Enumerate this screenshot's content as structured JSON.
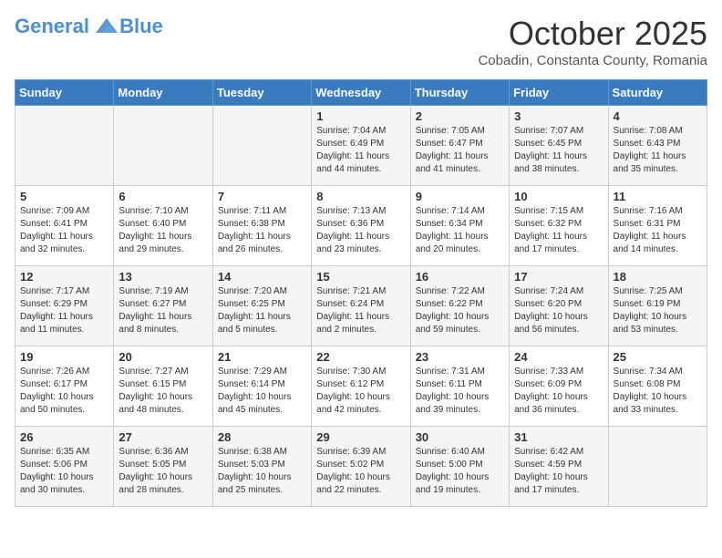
{
  "header": {
    "logo_line1": "General",
    "logo_line2": "Blue",
    "month": "October 2025",
    "location": "Cobadin, Constanta County, Romania"
  },
  "weekdays": [
    "Sunday",
    "Monday",
    "Tuesday",
    "Wednesday",
    "Thursday",
    "Friday",
    "Saturday"
  ],
  "weeks": [
    [
      {
        "day": "",
        "info": ""
      },
      {
        "day": "",
        "info": ""
      },
      {
        "day": "",
        "info": ""
      },
      {
        "day": "1",
        "info": "Sunrise: 7:04 AM\nSunset: 6:49 PM\nDaylight: 11 hours\nand 44 minutes."
      },
      {
        "day": "2",
        "info": "Sunrise: 7:05 AM\nSunset: 6:47 PM\nDaylight: 11 hours\nand 41 minutes."
      },
      {
        "day": "3",
        "info": "Sunrise: 7:07 AM\nSunset: 6:45 PM\nDaylight: 11 hours\nand 38 minutes."
      },
      {
        "day": "4",
        "info": "Sunrise: 7:08 AM\nSunset: 6:43 PM\nDaylight: 11 hours\nand 35 minutes."
      }
    ],
    [
      {
        "day": "5",
        "info": "Sunrise: 7:09 AM\nSunset: 6:41 PM\nDaylight: 11 hours\nand 32 minutes."
      },
      {
        "day": "6",
        "info": "Sunrise: 7:10 AM\nSunset: 6:40 PM\nDaylight: 11 hours\nand 29 minutes."
      },
      {
        "day": "7",
        "info": "Sunrise: 7:11 AM\nSunset: 6:38 PM\nDaylight: 11 hours\nand 26 minutes."
      },
      {
        "day": "8",
        "info": "Sunrise: 7:13 AM\nSunset: 6:36 PM\nDaylight: 11 hours\nand 23 minutes."
      },
      {
        "day": "9",
        "info": "Sunrise: 7:14 AM\nSunset: 6:34 PM\nDaylight: 11 hours\nand 20 minutes."
      },
      {
        "day": "10",
        "info": "Sunrise: 7:15 AM\nSunset: 6:32 PM\nDaylight: 11 hours\nand 17 minutes."
      },
      {
        "day": "11",
        "info": "Sunrise: 7:16 AM\nSunset: 6:31 PM\nDaylight: 11 hours\nand 14 minutes."
      }
    ],
    [
      {
        "day": "12",
        "info": "Sunrise: 7:17 AM\nSunset: 6:29 PM\nDaylight: 11 hours\nand 11 minutes."
      },
      {
        "day": "13",
        "info": "Sunrise: 7:19 AM\nSunset: 6:27 PM\nDaylight: 11 hours\nand 8 minutes."
      },
      {
        "day": "14",
        "info": "Sunrise: 7:20 AM\nSunset: 6:25 PM\nDaylight: 11 hours\nand 5 minutes."
      },
      {
        "day": "15",
        "info": "Sunrise: 7:21 AM\nSunset: 6:24 PM\nDaylight: 11 hours\nand 2 minutes."
      },
      {
        "day": "16",
        "info": "Sunrise: 7:22 AM\nSunset: 6:22 PM\nDaylight: 10 hours\nand 59 minutes."
      },
      {
        "day": "17",
        "info": "Sunrise: 7:24 AM\nSunset: 6:20 PM\nDaylight: 10 hours\nand 56 minutes."
      },
      {
        "day": "18",
        "info": "Sunrise: 7:25 AM\nSunset: 6:19 PM\nDaylight: 10 hours\nand 53 minutes."
      }
    ],
    [
      {
        "day": "19",
        "info": "Sunrise: 7:26 AM\nSunset: 6:17 PM\nDaylight: 10 hours\nand 50 minutes."
      },
      {
        "day": "20",
        "info": "Sunrise: 7:27 AM\nSunset: 6:15 PM\nDaylight: 10 hours\nand 48 minutes."
      },
      {
        "day": "21",
        "info": "Sunrise: 7:29 AM\nSunset: 6:14 PM\nDaylight: 10 hours\nand 45 minutes."
      },
      {
        "day": "22",
        "info": "Sunrise: 7:30 AM\nSunset: 6:12 PM\nDaylight: 10 hours\nand 42 minutes."
      },
      {
        "day": "23",
        "info": "Sunrise: 7:31 AM\nSunset: 6:11 PM\nDaylight: 10 hours\nand 39 minutes."
      },
      {
        "day": "24",
        "info": "Sunrise: 7:33 AM\nSunset: 6:09 PM\nDaylight: 10 hours\nand 36 minutes."
      },
      {
        "day": "25",
        "info": "Sunrise: 7:34 AM\nSunset: 6:08 PM\nDaylight: 10 hours\nand 33 minutes."
      }
    ],
    [
      {
        "day": "26",
        "info": "Sunrise: 6:35 AM\nSunset: 5:06 PM\nDaylight: 10 hours\nand 30 minutes."
      },
      {
        "day": "27",
        "info": "Sunrise: 6:36 AM\nSunset: 5:05 PM\nDaylight: 10 hours\nand 28 minutes."
      },
      {
        "day": "28",
        "info": "Sunrise: 6:38 AM\nSunset: 5:03 PM\nDaylight: 10 hours\nand 25 minutes."
      },
      {
        "day": "29",
        "info": "Sunrise: 6:39 AM\nSunset: 5:02 PM\nDaylight: 10 hours\nand 22 minutes."
      },
      {
        "day": "30",
        "info": "Sunrise: 6:40 AM\nSunset: 5:00 PM\nDaylight: 10 hours\nand 19 minutes."
      },
      {
        "day": "31",
        "info": "Sunrise: 6:42 AM\nSunset: 4:59 PM\nDaylight: 10 hours\nand 17 minutes."
      },
      {
        "day": "",
        "info": ""
      }
    ]
  ]
}
